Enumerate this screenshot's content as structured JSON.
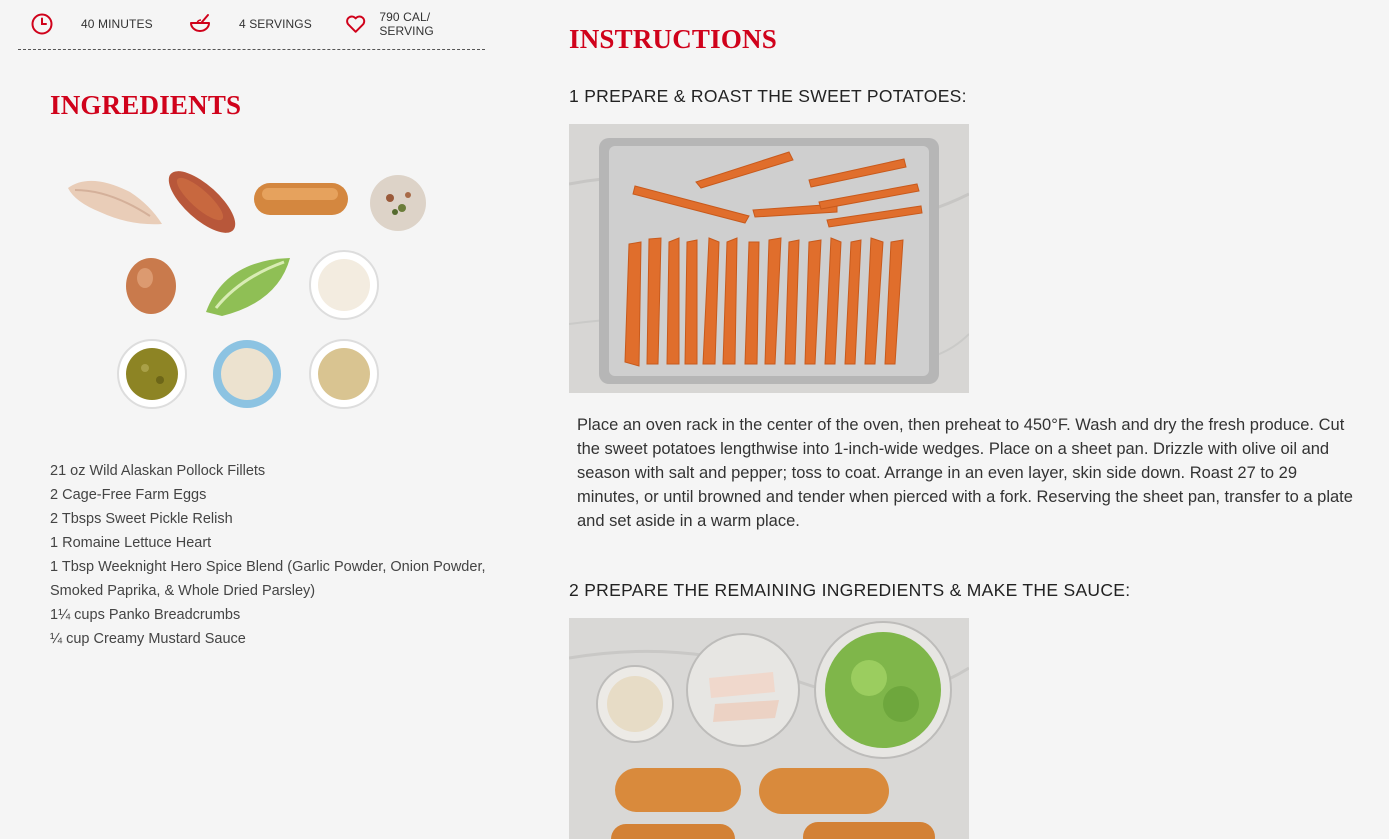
{
  "meta": {
    "time": "40 MINUTES",
    "servings": "4 SERVINGS",
    "calories": "790 CAL/ SERVING",
    "icons": [
      "clock-icon",
      "bowl-icon",
      "heart-icon"
    ],
    "accent_color": "#d0021b"
  },
  "ingredients": {
    "title": "INGREDIENTS",
    "items": [
      "21 oz Wild Alaskan Pollock Fillets",
      "2 Cage-Free Farm Eggs",
      "2 Tbsps Sweet Pickle Relish",
      "1 Romaine Lettuce Heart",
      "1 Tbsp Weeknight Hero Spice Blend (Garlic Powder, Onion Powder, Smoked Paprika, & Whole Dried Parsley)",
      "1¼ cups Panko Breadcrumbs",
      "¼ cup Creamy Mustard Sauce"
    ]
  },
  "instructions": {
    "title": "INSTRUCTIONS",
    "steps": [
      {
        "title": "1 PREPARE & ROAST THE SWEET POTATOES:",
        "text": "Place an oven rack in the center of the oven, then preheat to 450°F. Wash and dry the fresh produce. Cut the sweet potatoes lengthwise into 1-inch-wide wedges. Place on a sheet pan. Drizzle with olive oil and season with salt and pepper; toss to coat. Arrange in an even layer, skin side down. Roast 27 to 29 minutes, or until browned and tender when pierced with a fork. Reserving the sheet pan, transfer to a plate and set aside in a warm place."
      },
      {
        "title": "2 PREPARE THE REMAINING INGREDIENTS & MAKE THE SAUCE:"
      }
    ]
  }
}
